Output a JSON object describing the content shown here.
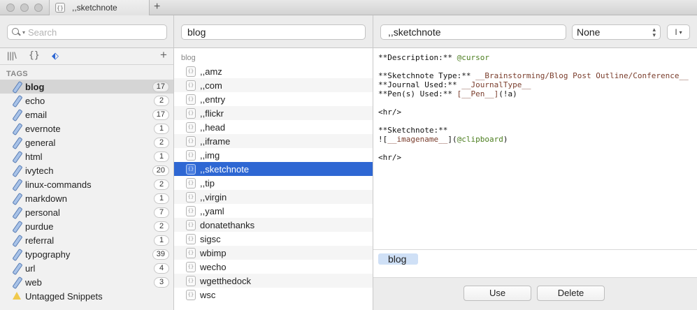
{
  "tab": {
    "title": ",,sketchnote",
    "icon": "snippet-icon",
    "new_tab_label": "+"
  },
  "left": {
    "search_placeholder": "Search",
    "icons": {
      "library": "library-icon",
      "snippets": "braces-icon",
      "tags": "tag-icon",
      "add": "+"
    },
    "tags_heading": "TAGS",
    "tags": [
      {
        "label": "blog",
        "count": "17",
        "selected": true
      },
      {
        "label": "echo",
        "count": "2"
      },
      {
        "label": "email",
        "count": "17"
      },
      {
        "label": "evernote",
        "count": "1"
      },
      {
        "label": "general",
        "count": "2"
      },
      {
        "label": "html",
        "count": "1"
      },
      {
        "label": "ivytech",
        "count": "20"
      },
      {
        "label": "linux-commands",
        "count": "2"
      },
      {
        "label": "markdown",
        "count": "1"
      },
      {
        "label": "personal",
        "count": "7"
      },
      {
        "label": "purdue",
        "count": "2"
      },
      {
        "label": "referral",
        "count": "1"
      },
      {
        "label": "typography",
        "count": "39"
      },
      {
        "label": "url",
        "count": "4"
      },
      {
        "label": "web",
        "count": "3"
      }
    ],
    "untagged_label": "Untagged Snippets"
  },
  "middle": {
    "filter_value": "blog",
    "group_heading": "blog",
    "snippets": [
      ",,amz",
      ",,com",
      ",,entry",
      ",,flickr",
      ",,head",
      ",,iframe",
      ",,img",
      ",,sketchnote",
      ",,tip",
      ",,virgin",
      ",,yaml",
      "donatethanks",
      "sigsc",
      "wbimp",
      "wecho",
      "wgetthedock",
      "wsc"
    ],
    "selected_index": 7
  },
  "right": {
    "title_value": ",,sketchnote",
    "language_value": "None",
    "cursor_button": "I",
    "editor_lines": [
      [
        [
          "**Description:** ",
          ""
        ],
        [
          "@cursor",
          "var"
        ]
      ],
      [],
      [
        [
          "**Sketchnote Type:** ",
          ""
        ],
        [
          "__Brainstorming/Blog Post Outline/Conference__",
          "ph"
        ]
      ],
      [
        [
          "**Journal Used:** ",
          ""
        ],
        [
          "__JournalType__",
          "ph"
        ]
      ],
      [
        [
          "**Pen(s) Used:** ",
          ""
        ],
        [
          "[__Pen__]",
          "ph"
        ],
        [
          "(!a)",
          ""
        ]
      ],
      [],
      [
        [
          "<hr/>",
          ""
        ]
      ],
      [],
      [
        [
          "**Sketchnote:**",
          ""
        ]
      ],
      [
        [
          "![",
          ""
        ],
        [
          "__imagename__",
          "ph"
        ],
        [
          "](",
          ""
        ],
        [
          "@clipboard",
          "var"
        ],
        [
          ")",
          ""
        ]
      ],
      [],
      [
        [
          "<hr/>",
          ""
        ]
      ]
    ],
    "tag_chip": "blog",
    "use_button": "Use",
    "delete_button": "Delete"
  },
  "colors": {
    "selection": "#2e67d3",
    "tag_chip": "#cfe0f6",
    "placeholder_token": "#7a3d2c",
    "variable_token": "#4b7d1e"
  }
}
